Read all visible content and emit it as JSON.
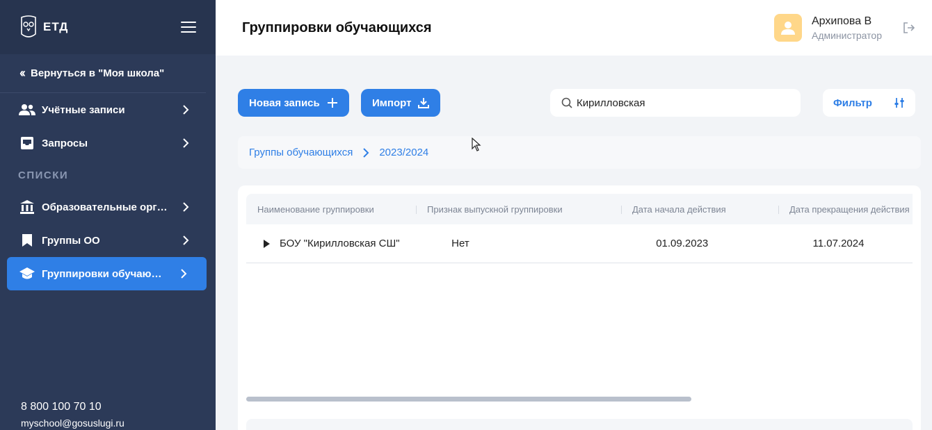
{
  "sidebar": {
    "logo_text": "ЕТД",
    "back_label": "Вернуться в \"Моя школа\"",
    "items": [
      {
        "label": "Учётные записи",
        "icon": "users-icon"
      },
      {
        "label": "Запросы",
        "icon": "inbox-icon"
      }
    ],
    "section_title": "СПИСКИ",
    "list_items": [
      {
        "label": "Образовательные организации",
        "icon": "institution-icon"
      },
      {
        "label": "Группы ОО",
        "icon": "bookmark-icon"
      },
      {
        "label": "Группировки обучающихся",
        "icon": "graduation-cap-icon",
        "active": true
      }
    ],
    "phone": "8 800 100 70 10",
    "email": "myschool@gosuslugi.ru"
  },
  "header": {
    "title": "Группировки обучающихся",
    "user_name": "Архипова В",
    "user_role": "Администратор"
  },
  "toolbar": {
    "new_record_label": "Новая запись",
    "import_label": "Импорт",
    "search_value": "Кирилловская",
    "filter_label": "Фильтр"
  },
  "breadcrumb": {
    "items": [
      "Группы обучающихся",
      "2023/2024"
    ]
  },
  "table": {
    "columns": [
      "Наименование группировки",
      "Признак выпускной группировки",
      "Дата начала действия",
      "Дата прекращения действия"
    ],
    "rows": [
      {
        "name": "БОУ \"Кирилловская СШ\"",
        "graduation": "Нет",
        "start": "01.09.2023",
        "end": "11.07.2024"
      }
    ]
  },
  "colors": {
    "sidebar_bg": "#2c3a58",
    "accent": "#2f7fe6",
    "avatar_bg": "#ffd789"
  }
}
